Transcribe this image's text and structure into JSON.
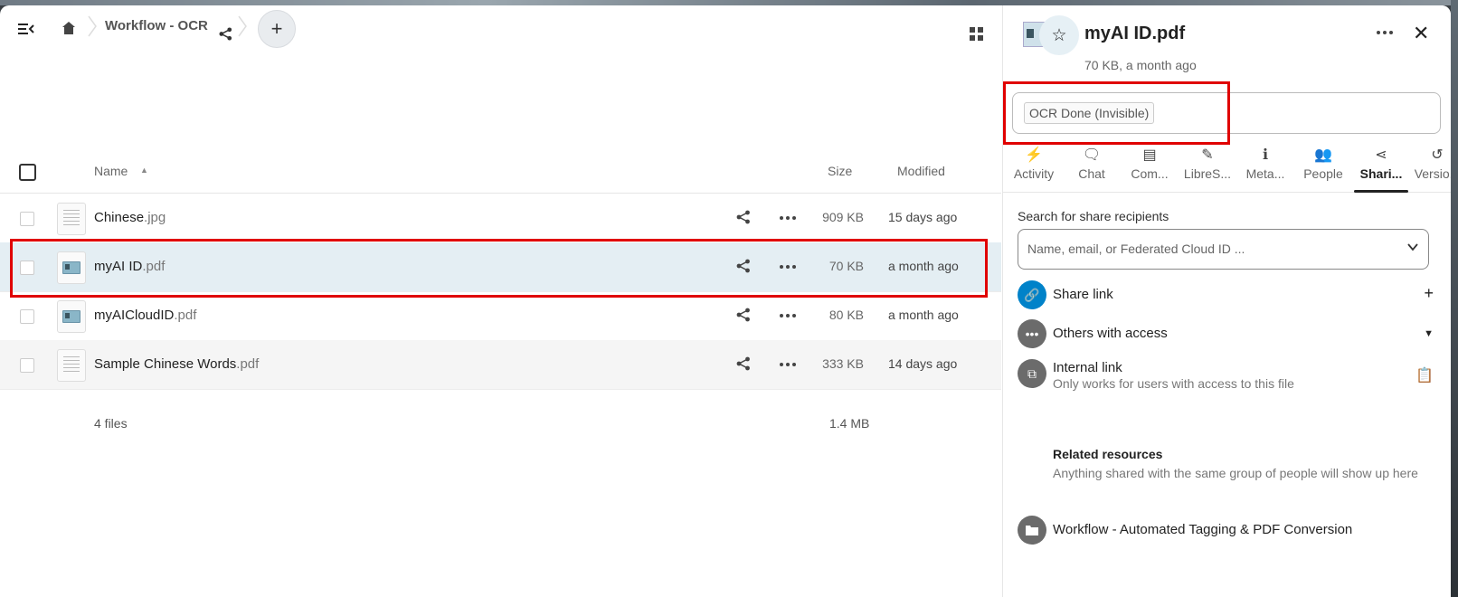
{
  "breadcrumb": {
    "folder": "Workflow - OCR"
  },
  "file_list": {
    "columns": {
      "name": "Name",
      "size": "Size",
      "modified": "Modified"
    },
    "rows": [
      {
        "base": "Chinese",
        "ext": ".jpg",
        "size": "909 KB",
        "modified": "15 days ago",
        "thumb": "text-page"
      },
      {
        "base": "myAI ID",
        "ext": ".pdf",
        "size": "70 KB",
        "modified": "a month ago",
        "thumb": "id-card"
      },
      {
        "base": "myAICloudID",
        "ext": ".pdf",
        "size": "80 KB",
        "modified": "a month ago",
        "thumb": "id-card"
      },
      {
        "base": "Sample Chinese Words",
        "ext": ".pdf",
        "size": "333 KB",
        "modified": "14 days ago",
        "thumb": "text-page"
      }
    ],
    "summary": {
      "count": "4 files",
      "total": "1.4 MB"
    }
  },
  "sidebar": {
    "title": "myAI ID.pdf",
    "subtitle": "70 KB, a month ago",
    "tag": "OCR Done (Invisible)",
    "tabs": [
      {
        "icon": "⚡",
        "label": "Activity"
      },
      {
        "icon": "🗨",
        "label": "Chat"
      },
      {
        "icon": "▤",
        "label": "Com..."
      },
      {
        "icon": "✎",
        "label": "LibreS..."
      },
      {
        "icon": "ℹ",
        "label": "Meta..."
      },
      {
        "icon": "👥",
        "label": "People"
      },
      {
        "icon": "⋖",
        "label": "Shari..."
      },
      {
        "icon": "↺",
        "label": "Versio..."
      }
    ],
    "search_label": "Search for share recipients",
    "search_placeholder": "Name, email, or Federated Cloud ID ...",
    "share_link": "Share link",
    "others_access": "Others with access",
    "internal_link": "Internal link",
    "internal_link_sub": "Only works for users with access to this file",
    "related_title": "Related resources",
    "related_desc": "Anything shared with the same group of people will show up here",
    "related_item": "Workflow - Automated Tagging & PDF Conversion"
  },
  "colors": {
    "selected_row": "#e4eef3",
    "highlight": "#e00000",
    "share_link_avatar": "#0082c9",
    "neutral_avatar": "#6b6b6b"
  }
}
